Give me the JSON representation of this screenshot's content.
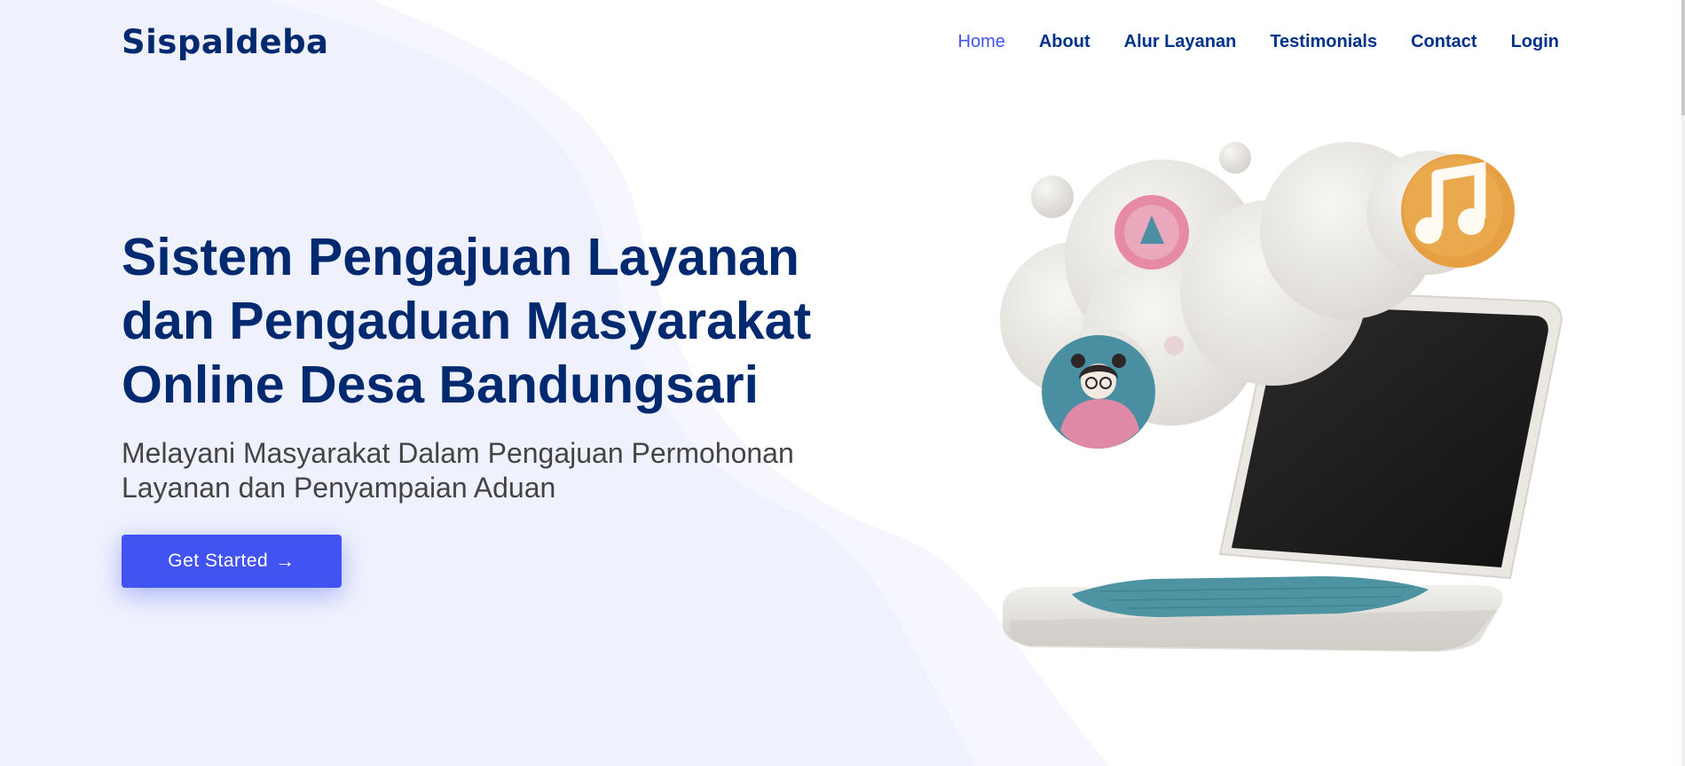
{
  "brand": "Sispaldeba",
  "nav": {
    "items": [
      {
        "label": "Home",
        "active": true
      },
      {
        "label": "About"
      },
      {
        "label": "Alur Layanan"
      },
      {
        "label": "Testimonials"
      },
      {
        "label": "Contact"
      },
      {
        "label": "Login"
      }
    ]
  },
  "hero": {
    "title": "Sistem Pengajuan Layanan dan Pengaduan Masyarakat Online Desa Bandungsari",
    "subtitle": "Melayani Masyarakat Dalam Pengajuan Permohonan Layanan dan Penyampaian Aduan",
    "cta_label": "Get Started",
    "cta_icon": "arrow-right-icon"
  },
  "colors": {
    "primary": "#4154f1",
    "navy": "#012970",
    "text_gray": "#444444",
    "wave_bg": "#f0f3fd"
  }
}
